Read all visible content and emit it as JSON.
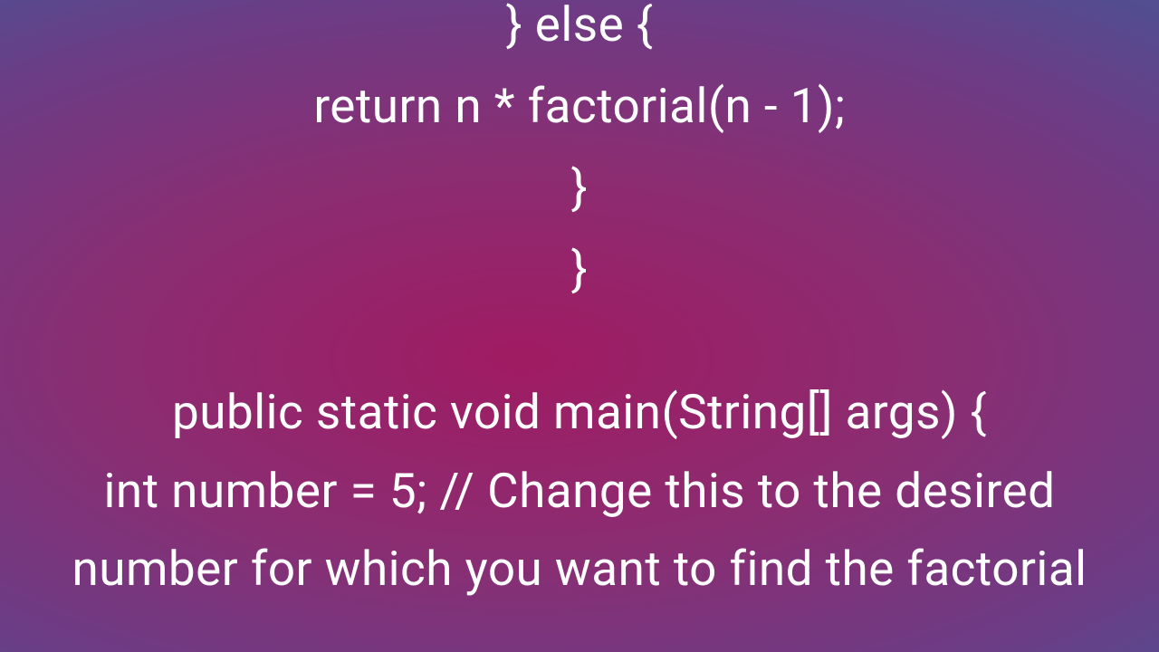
{
  "code": {
    "line1": "} else {",
    "line2": "return n * factorial(n - 1);",
    "line3": "}",
    "line4": "}",
    "line5": "public static void main(String[] args) {",
    "line6": "int number = 5; // Change this to the desired number for which you want to find the factorial"
  }
}
